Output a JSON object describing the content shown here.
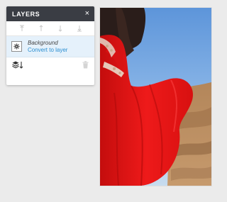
{
  "panel": {
    "title": "LAYERS",
    "close_label": "×"
  },
  "order_bar": {
    "icons": [
      "bring-to-front-icon",
      "bring-forward-icon",
      "send-backward-icon",
      "send-to-back-icon"
    ]
  },
  "layer": {
    "name": "Background",
    "action_label": "Convert to layer"
  },
  "colors": {
    "header_bg": "#3a3d44",
    "selected_row_bg": "#e5f1fb",
    "link": "#2b8fd1",
    "dress_red": "#e31212"
  }
}
